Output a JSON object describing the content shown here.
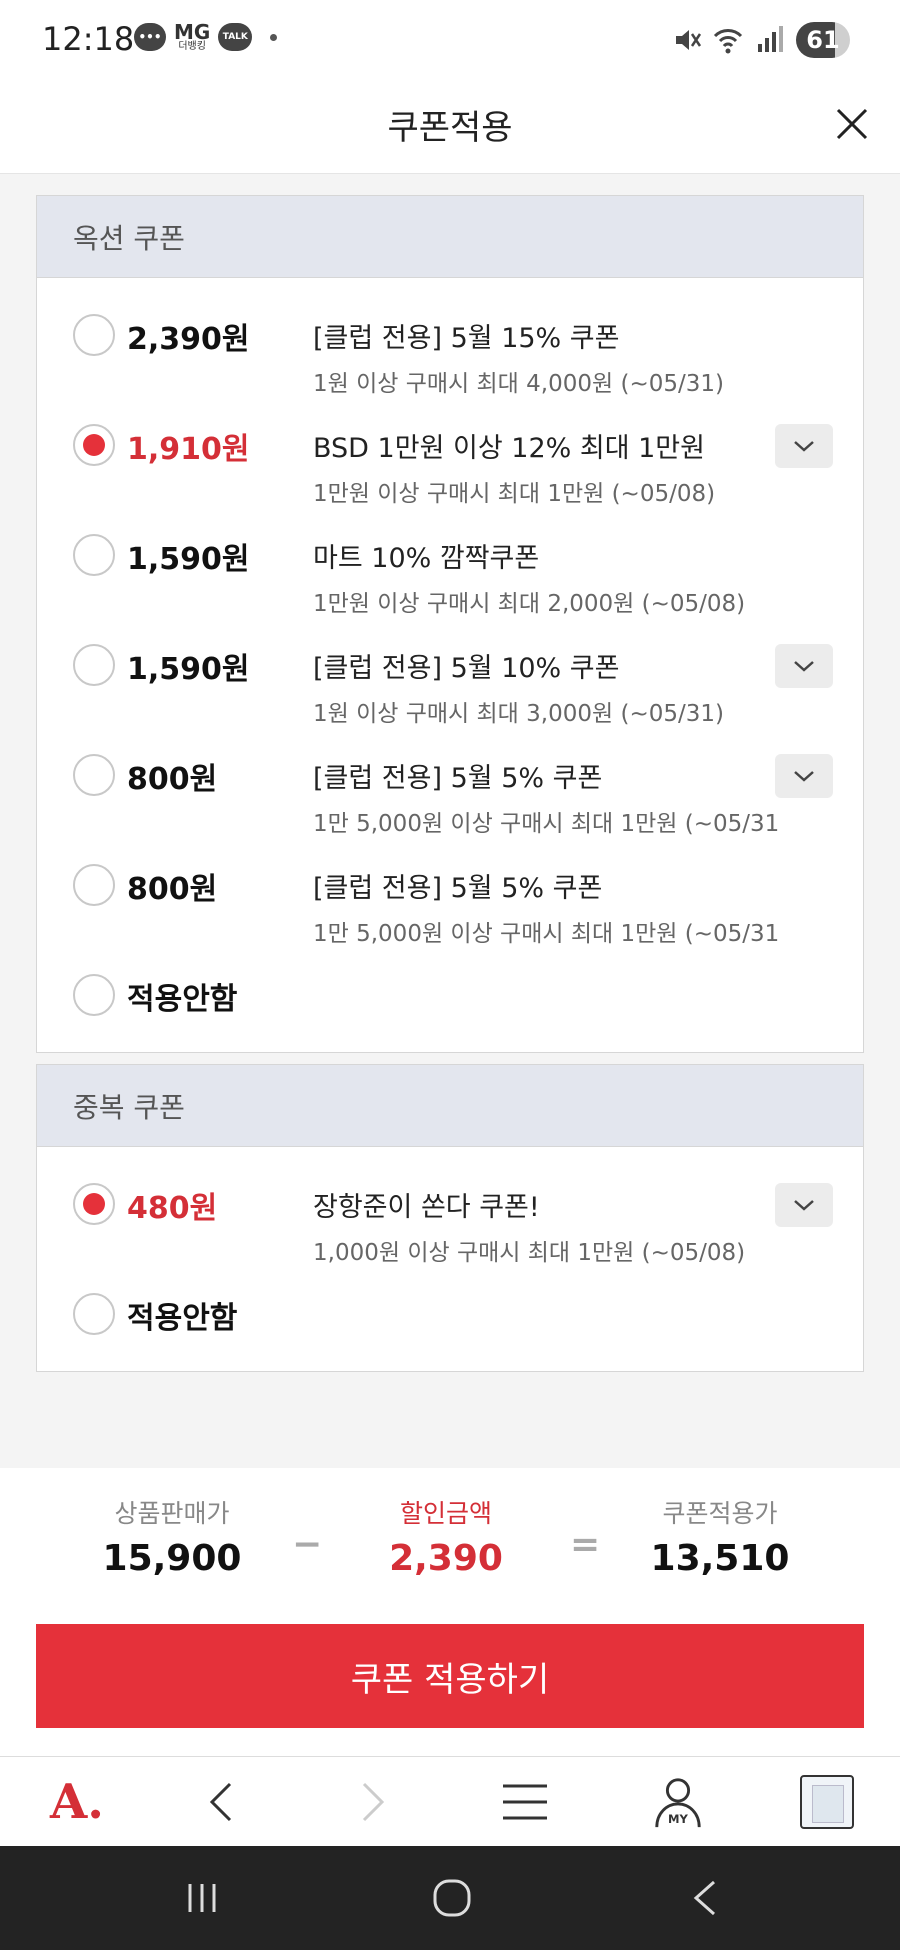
{
  "status_bar": {
    "time": "12:18",
    "notif_mg": "MG",
    "notif_mg_sub": "더뱅킹",
    "notif_talk": "TALK",
    "battery": "61"
  },
  "header": {
    "title": "쿠폰적용"
  },
  "auction_section": {
    "title": "옥션 쿠폰",
    "coupons": [
      {
        "amount": "2,390원",
        "title": "[클럽 전용] 5월 15% 쿠폰",
        "desc": "1원 이상 구매시 최대 4,000원 (~05/31)"
      },
      {
        "amount": "1,910원",
        "title": "BSD 1만원 이상 12% 최대 1만원",
        "desc": "1만원 이상 구매시 최대 1만원 (~05/08)"
      },
      {
        "amount": "1,590원",
        "title": "마트 10% 깜짝쿠폰",
        "desc": "1만원 이상 구매시 최대 2,000원 (~05/08)"
      },
      {
        "amount": "1,590원",
        "title": "[클럽 전용] 5월 10% 쿠폰",
        "desc": "1원 이상 구매시 최대 3,000원 (~05/31)"
      },
      {
        "amount": "800원",
        "title": "[클럽 전용] 5월 5% 쿠폰",
        "desc": "1만 5,000원 이상 구매시 최대 1만원 (~05/31"
      },
      {
        "amount": "800원",
        "title": "[클럽 전용] 5월 5% 쿠폰",
        "desc": "1만 5,000원 이상 구매시 최대 1만원 (~05/31"
      }
    ],
    "none_label": "적용안함"
  },
  "duplicate_section": {
    "title": "중복 쿠폰",
    "coupons": [
      {
        "amount": "480원",
        "title": "장항준이 쏜다 쿠폰!",
        "desc": "1,000원 이상 구매시 최대 1만원 (~05/08)"
      }
    ],
    "none_label": "적용안함"
  },
  "totals": {
    "price_label": "상품판매가",
    "price_value": "15,900",
    "minus": "−",
    "discount_label": "할인금액",
    "discount_value": "2,390",
    "equals": "=",
    "final_label": "쿠폰적용가",
    "final_value": "13,510"
  },
  "apply_button": "쿠폰 적용하기",
  "browser_nav": {
    "logo": "A.",
    "my_label": "MY"
  },
  "colors": {
    "accent": "#e5313a",
    "selected_text": "#d42f37",
    "section_header_bg": "#e3e6ee"
  }
}
